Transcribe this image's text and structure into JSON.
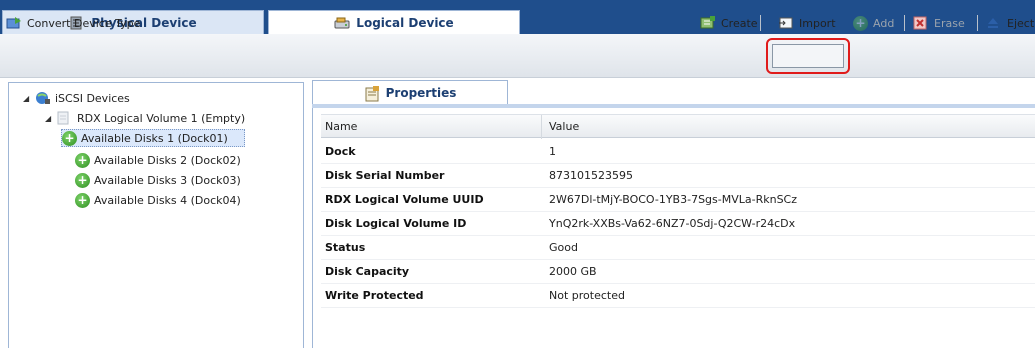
{
  "tabs": {
    "physical": "Physical Device",
    "logical": "Logical Device"
  },
  "toolbar": {
    "convert": "Convert Device Type",
    "create": "Create",
    "import": "Import",
    "add": "Add",
    "erase": "Erase",
    "eject": "Eject"
  },
  "tree": {
    "root": "iSCSI Devices",
    "volume": "RDX Logical Volume 1 (Empty)",
    "disks": [
      "Available Disks 1 (Dock01)",
      "Available Disks 2 (Dock02)",
      "Available Disks 3 (Dock03)",
      "Available Disks 4 (Dock04)"
    ]
  },
  "properties": {
    "tab": "Properties",
    "headers": {
      "name": "Name",
      "value": "Value"
    },
    "rows": [
      {
        "name": "Dock",
        "value": "1"
      },
      {
        "name": "Disk Serial Number",
        "value": "873101523595"
      },
      {
        "name": "RDX Logical Volume UUID",
        "value": "2W67Dl-tMjY-BOCO-1YB3-7Sgs-MVLa-RknSCz"
      },
      {
        "name": "Disk Logical Volume ID",
        "value": "YnQ2rk-XXBs-Va62-6NZ7-0Sdj-Q2CW-r24cDx"
      },
      {
        "name": "Status",
        "value": "Good"
      },
      {
        "name": "Disk Capacity",
        "value": "2000 GB"
      },
      {
        "name": "Write Protected",
        "value": "Not protected"
      }
    ]
  },
  "colors": {
    "topbar": "#1f4e8c",
    "highlight": "#e01b1b",
    "selection": "#dbe8fb"
  }
}
